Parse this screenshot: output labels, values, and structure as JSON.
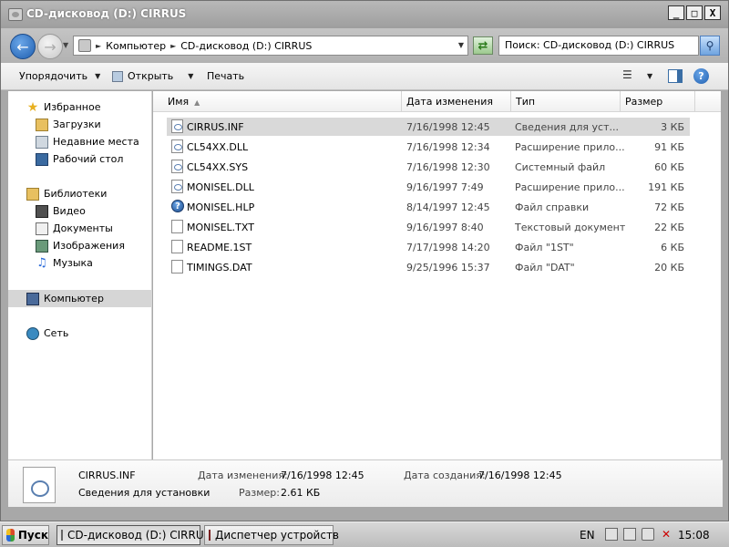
{
  "window": {
    "title": "CD-дисковод (D:) CIRRUS",
    "controls": [
      "_",
      "□",
      "X"
    ]
  },
  "navbar": {
    "back_icon": "back-arrow-icon",
    "forward_icon": "forward-arrow-icon",
    "breadcrumb": [
      "Компьютер",
      "CD-дисковод (D:) CIRRUS"
    ],
    "search_placeholder": "Поиск: CD-дисковод (D:) CIRRUS"
  },
  "toolbar": {
    "organize_label": "Упорядочить",
    "open_label": "Открыть",
    "print_label": "Печать"
  },
  "navpane": {
    "favorites": {
      "label": "Избранное",
      "items": [
        "Загрузки",
        "Недавние места",
        "Рабочий стол"
      ]
    },
    "libraries": {
      "label": "Библиотеки",
      "items": [
        "Видео",
        "Документы",
        "Изображения",
        "Музыка"
      ]
    },
    "computer_label": "Компьютер",
    "network_label": "Сеть"
  },
  "columns": {
    "name": "Имя",
    "date": "Дата изменения",
    "type": "Тип",
    "size": "Размер"
  },
  "files": [
    {
      "name": "CIRRUS.INF",
      "date": "7/16/1998 12:45",
      "type": "Сведения для уст...",
      "size": "3 КБ",
      "icon": "inf",
      "selected": true
    },
    {
      "name": "CL54XX.DLL",
      "date": "7/16/1998 12:34",
      "type": "Расширение прило...",
      "size": "91 КБ",
      "icon": "sys"
    },
    {
      "name": "CL54XX.SYS",
      "date": "7/16/1998 12:30",
      "type": "Системный файл",
      "size": "60 КБ",
      "icon": "sys"
    },
    {
      "name": "MONISEL.DLL",
      "date": "9/16/1997 7:49",
      "type": "Расширение прило...",
      "size": "191 КБ",
      "icon": "sys"
    },
    {
      "name": "MONISEL.HLP",
      "date": "8/14/1997 12:45",
      "type": "Файл справки",
      "size": "72 КБ",
      "icon": "help"
    },
    {
      "name": "MONISEL.TXT",
      "date": "9/16/1997 8:40",
      "type": "Текстовый документ",
      "size": "22 КБ",
      "icon": "txt"
    },
    {
      "name": "README.1ST",
      "date": "7/17/1998 14:20",
      "type": "Файл \"1ST\"",
      "size": "6 КБ",
      "icon": "txt"
    },
    {
      "name": "TIMINGS.DAT",
      "date": "9/25/1996 15:37",
      "type": "Файл \"DAT\"",
      "size": "20 КБ",
      "icon": "txt"
    }
  ],
  "details": {
    "filename": "CIRRUS.INF",
    "filetype": "Сведения для установки",
    "modified_label": "Дата изменения:",
    "modified_value": "7/16/1998 12:45",
    "created_label": "Дата создания:",
    "created_value": "7/16/1998 12:45",
    "size_label": "Размер:",
    "size_value": "2.61 КБ"
  },
  "taskbar": {
    "start_label": "Пуск",
    "tasks": [
      "CD-дисковод (D:) CIRRUS",
      "Диспетчер устройств"
    ],
    "language": "EN",
    "clock": "15:08"
  }
}
